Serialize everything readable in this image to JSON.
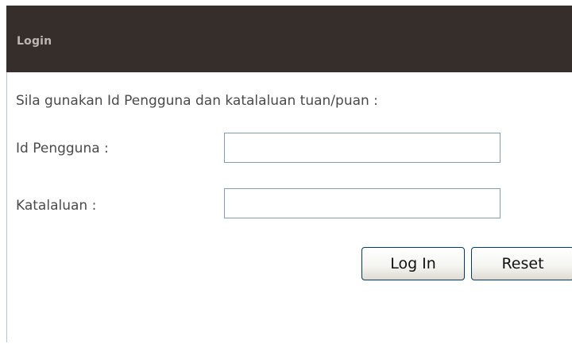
{
  "header": {
    "title": "Login"
  },
  "form": {
    "instruction": "Sila gunakan Id Pengguna dan katalaluan tuan/puan :",
    "user_id_label": "Id Pengguna :",
    "user_id_value": "",
    "password_label": "Katalaluan :",
    "password_value": "",
    "login_button_label": "Log In",
    "reset_button_label": "Reset"
  },
  "colors": {
    "header_background": "#352e2b",
    "header_text": "#bdb6b2",
    "input_border": "#7f9db9",
    "button_border": "#003c74"
  }
}
